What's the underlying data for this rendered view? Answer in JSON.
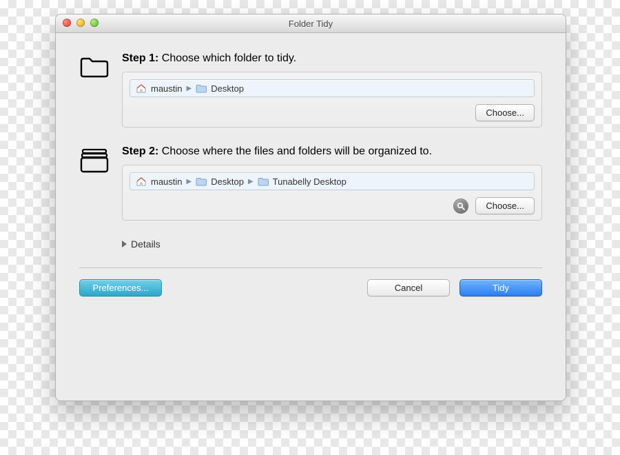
{
  "window": {
    "title": "Folder Tidy"
  },
  "step1": {
    "label_bold": "Step 1:",
    "label_rest": " Choose which folder to tidy.",
    "path": [
      {
        "icon": "home",
        "text": "maustin"
      },
      {
        "icon": "folder",
        "text": "Desktop"
      }
    ],
    "choose": "Choose..."
  },
  "step2": {
    "label_bold": "Step 2:",
    "label_rest": " Choose where the files and folders will be organized to.",
    "path": [
      {
        "icon": "home",
        "text": "maustin"
      },
      {
        "icon": "folder",
        "text": "Desktop"
      },
      {
        "icon": "folder",
        "text": "Tunabelly Desktop"
      }
    ],
    "choose": "Choose..."
  },
  "details_label": "Details",
  "footer": {
    "preferences": "Preferences...",
    "cancel": "Cancel",
    "tidy": "Tidy"
  }
}
